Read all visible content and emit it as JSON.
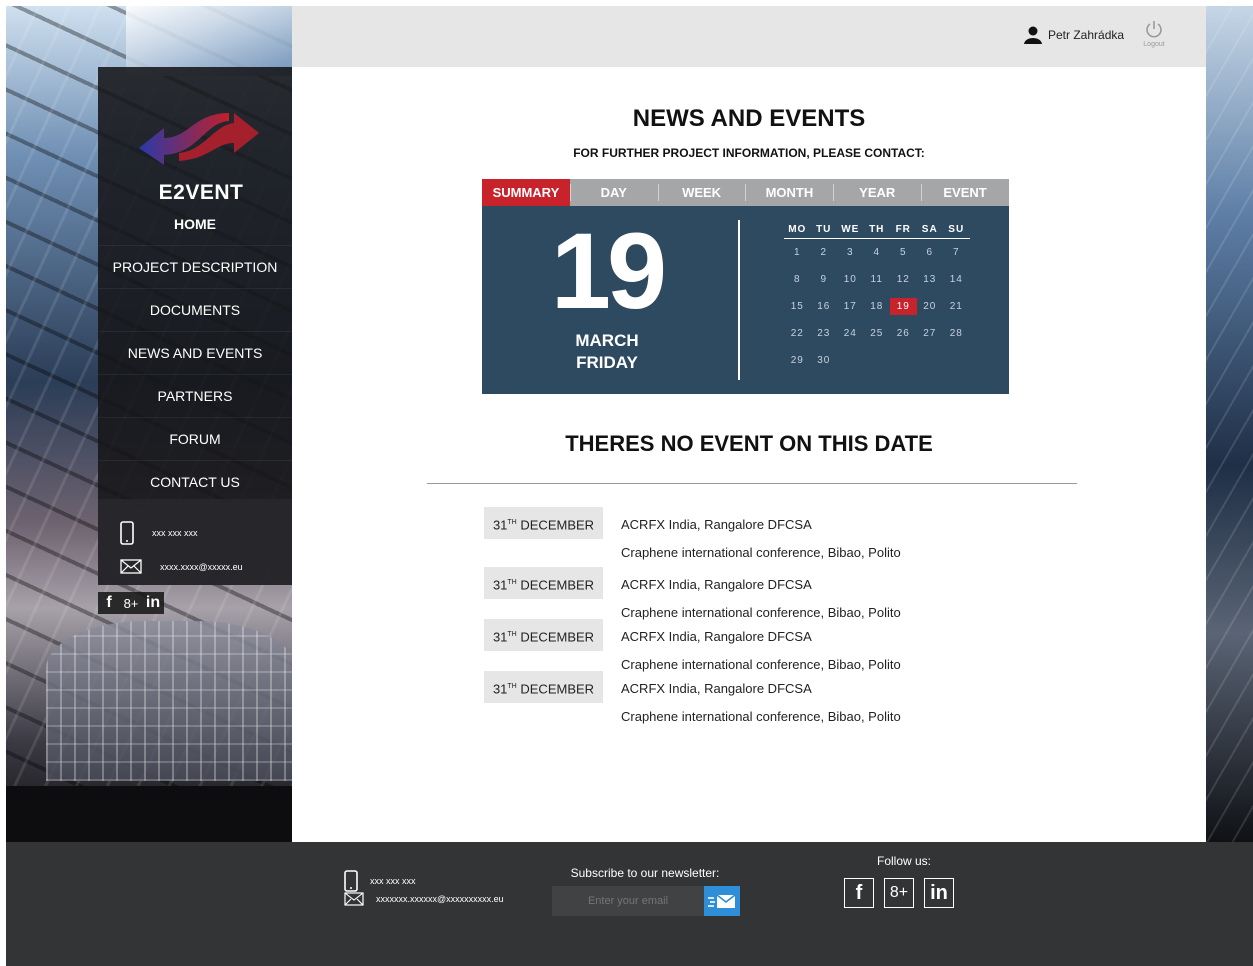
{
  "header": {
    "user_name": "Petr Zahrádka",
    "logout_label": "Logout"
  },
  "sidebar": {
    "logo_text": "E2VENT",
    "items": [
      {
        "label": "HOME",
        "active": true
      },
      {
        "label": "PROJECT DESCRIPTION"
      },
      {
        "label": "DOCUMENTS"
      },
      {
        "label": "NEWS AND EVENTS"
      },
      {
        "label": "PARTNERS"
      },
      {
        "label": "FORUM"
      },
      {
        "label": "CONTACT US"
      }
    ],
    "phone": "xxx xxx xxx",
    "email": "xxxx.xxxx@xxxxx.eu",
    "social": [
      "f",
      "8+",
      "in"
    ]
  },
  "main": {
    "title": "NEWS AND EVENTS",
    "subtitle": "FOR FURTHER PROJECT INFORMATION, PLEASE CONTACT:",
    "calendar": {
      "tabs": [
        "SUMMARY",
        "DAY",
        "WEEK",
        "MONTH",
        "YEAR",
        "EVENT"
      ],
      "active_tab": "SUMMARY",
      "day": "19",
      "month": "MARCH",
      "weekday": "FRIDAY",
      "weekday_headers": [
        "MO",
        "TU",
        "WE",
        "TH",
        "FR",
        "SA",
        "SU"
      ],
      "weeks": [
        [
          "1",
          "2",
          "3",
          "4",
          "5",
          "6",
          "7"
        ],
        [
          "8",
          "9",
          "10",
          "11",
          "12",
          "13",
          "14"
        ],
        [
          "15",
          "16",
          "17",
          "18",
          "19",
          "20",
          "21"
        ],
        [
          "22",
          "23",
          "24",
          "25",
          "26",
          "27",
          "28"
        ],
        [
          "29",
          "30",
          "",
          "",
          "",
          "",
          ""
        ]
      ],
      "selected": "19",
      "accent_color": "#c8222a",
      "panel_color": "#2e4a61"
    },
    "no_event_message": "THERES NO EVENT ON THIS DATE",
    "events": [
      {
        "date_num": "31",
        "date_sup": "TH",
        "date_month": "DECEMBER",
        "line1": "ACRFX India, Rangalore DFCSA",
        "line2": "Craphene international conference, Bibao, Polito"
      },
      {
        "date_num": "31",
        "date_sup": "TH",
        "date_month": "DECEMBER",
        "line1": "ACRFX India, Rangalore DFCSA",
        "line2": "Craphene international conference, Bibao, Polito"
      },
      {
        "date_num": "31",
        "date_sup": "TH",
        "date_month": "DECEMBER",
        "line1": "ACRFX India, Rangalore DFCSA",
        "line2": "Craphene international conference, Bibao, Polito"
      },
      {
        "date_num": "31",
        "date_sup": "TH",
        "date_month": "DECEMBER",
        "line1": "ACRFX India, Rangalore DFCSA",
        "line2": "Craphene international conference, Bibao, Polito"
      }
    ]
  },
  "footer": {
    "phone": "xxx xxx xxx",
    "email": "xxxxxxx.xxxxxx@xxxxxxxxxx.eu",
    "newsletter_label": "Subscribe to our newsletter:",
    "email_placeholder": "Enter your email",
    "follow_label": "Follow us:",
    "social": [
      "f",
      "8+",
      "in"
    ]
  }
}
